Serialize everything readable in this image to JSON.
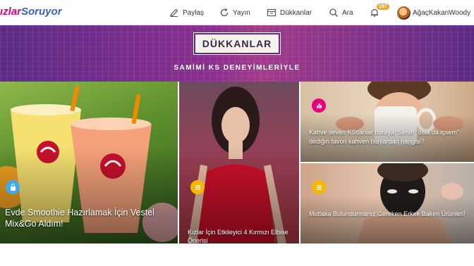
{
  "header": {
    "logo_part1": "ızlar",
    "logo_part2": "Soruyor",
    "nav": [
      {
        "label": "Paylaş",
        "icon": "pencil-icon"
      },
      {
        "label": "Yayın",
        "icon": "refresh-icon"
      },
      {
        "label": "Dükkanlar",
        "icon": "store-icon"
      },
      {
        "label": "Ara",
        "icon": "search-icon"
      }
    ],
    "notification_count": "157",
    "username": "AğaçKakanWoody"
  },
  "banner": {
    "button_label": "DÜKKANLAR",
    "subtitle": "SAMİMİ KS DENEYİMLERİYLE"
  },
  "cards": [
    {
      "caption": "Evde Smoothie Hazırlamak İçin Vestel Mix&Go Aldım!",
      "category_icon": "shopping-bag-icon",
      "category_color": "#3fa9f5"
    },
    {
      "caption": "Kızlar İçin Etkileyici 4 Kırmızı Elbise Önerisi",
      "category_icon": "list-icon",
      "category_color": "#f5b800"
    },
    {
      "caption": "Kahve seven KScanlar buraya! Senin \"olsa da içsem\" dediğin favori kahven bunlardan hangisi?",
      "category_icon": "bar-chart-icon",
      "category_color": "#e6007e"
    },
    {
      "caption": "Mutlaka Bulundurmanız Gereken Erkek Bakım Ürünleri!",
      "category_icon": "list-icon",
      "category_color": "#f5b800"
    }
  ],
  "colors": {
    "brand_pink": "#e6007e",
    "brand_blue": "#3b5fc0",
    "banner_purple": "#5b2a86",
    "badge_orange": "#f5a623"
  }
}
